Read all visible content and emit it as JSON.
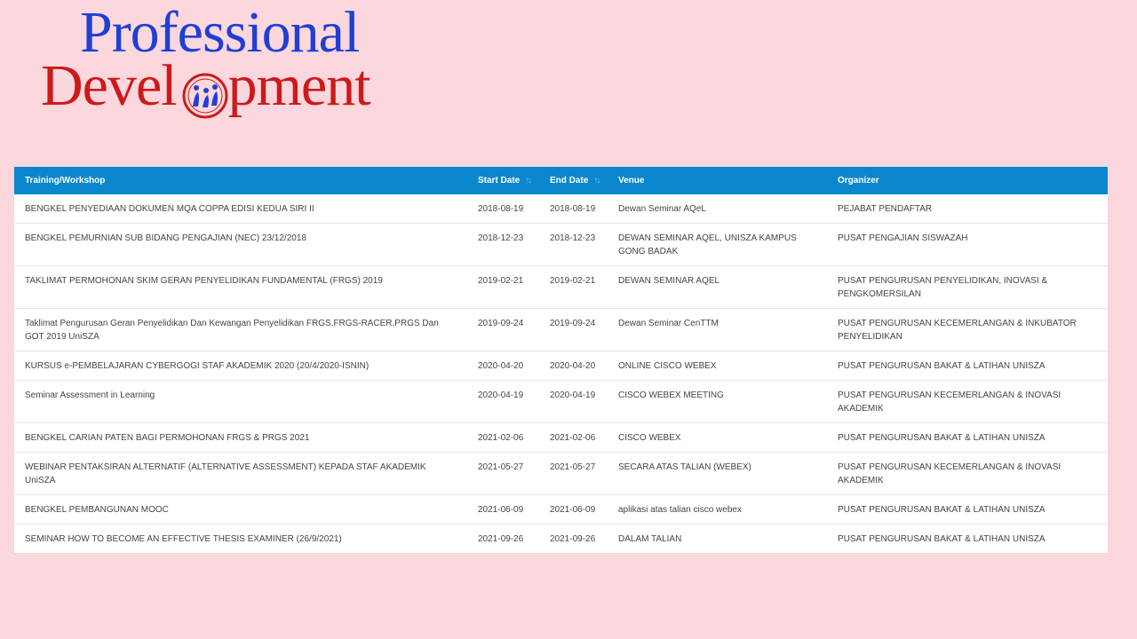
{
  "logo": {
    "line1": "Professional",
    "line2_start": "Devel",
    "line2_end": "pment"
  },
  "table": {
    "columns": [
      {
        "label": "Training/Workshop",
        "sortable": false
      },
      {
        "label": "Start Date",
        "sortable": true
      },
      {
        "label": "End Date",
        "sortable": true
      },
      {
        "label": "Venue",
        "sortable": false
      },
      {
        "label": "Organizer",
        "sortable": false
      }
    ],
    "rows": [
      [
        "BENGKEL PENYEDIAAN DOKUMEN MQA COPPA EDISI KEDUA SIRI II",
        "2018-08-19",
        "2018-08-19",
        "Dewan Seminar AQeL",
        "PEJABAT PENDAFTAR"
      ],
      [
        "BENGKEL PEMURNIAN SUB BIDANG PENGAJIAN (NEC) 23/12/2018",
        "2018-12-23",
        "2018-12-23",
        "DEWAN SEMINAR AQEL, UNISZA KAMPUS GONG BADAK",
        "PUSAT PENGAJIAN SISWAZAH"
      ],
      [
        "TAKLIMAT PERMOHONAN SKIM GERAN PENYELIDIKAN FUNDAMENTAL (FRGS) 2019",
        "2019-02-21",
        "2019-02-21",
        "DEWAN SEMINAR AQEL",
        "PUSAT PENGURUSAN PENYELIDIKAN, INOVASI & PENGKOMERSILAN"
      ],
      [
        "Taklimat Pengurusan Geran Penyelidikan Dan Kewangan Penyelidikan FRGS,FRGS-RACER,PRGS Dan GOT 2019 UniSZA",
        "2019-09-24",
        "2019-09-24",
        "Dewan Seminar CenTTM",
        "PUSAT PENGURUSAN KECEMERLANGAN & INKUBATOR PENYELIDIKAN"
      ],
      [
        "KURSUS e-PEMBELAJARAN CYBERGOGI STAF AKADEMIK 2020 (20/4/2020-ISNIN)",
        "2020-04-20",
        "2020-04-20",
        "ONLINE CISCO WEBEX",
        "PUSAT PENGURUSAN BAKAT & LATIHAN UNISZA"
      ],
      [
        "Seminar Assessment in Learning",
        "2020-04-19",
        "2020-04-19",
        "CISCO WEBEX MEETING",
        "PUSAT PENGURUSAN KECEMERLANGAN & INOVASI AKADEMIK"
      ],
      [
        "BENGKEL CARIAN PATEN BAGI PERMOHONAN FRGS & PRGS 2021",
        "2021-02-06",
        "2021-02-06",
        "CISCO WEBEX",
        "PUSAT PENGURUSAN BAKAT & LATIHAN UNISZA"
      ],
      [
        "WEBINAR PENTAKSIRAN ALTERNATIF (ALTERNATIVE ASSESSMENT) KEPADA STAF AKADEMIK UniSZA",
        "2021-05-27",
        "2021-05-27",
        "SECARA ATAS TALIAN (WEBEX)",
        "PUSAT PENGURUSAN KECEMERLANGAN & INOVASI AKADEMIK"
      ],
      [
        "BENGKEL PEMBANGUNAN MOOC",
        "2021-06-09",
        "2021-06-09",
        "aplikasi atas talian cisco webex",
        "PUSAT PENGURUSAN BAKAT & LATIHAN UNISZA"
      ],
      [
        "SEMINAR HOW TO BECOME AN EFFECTIVE THESIS EXAMINER (26/9/2021)",
        "2021-09-26",
        "2021-09-26",
        "DALAM TALIAN",
        "PUSAT PENGURUSAN BAKAT & LATIHAN UNISZA"
      ]
    ]
  },
  "colors": {
    "background": "#fcd7dd",
    "header": "#0a87cc",
    "logo_blue": "#1f3fd6",
    "logo_red": "#cc1a1a"
  },
  "icons": {
    "sort": "sort-arrows-icon",
    "emblem": "people-circle-emblem-icon"
  }
}
